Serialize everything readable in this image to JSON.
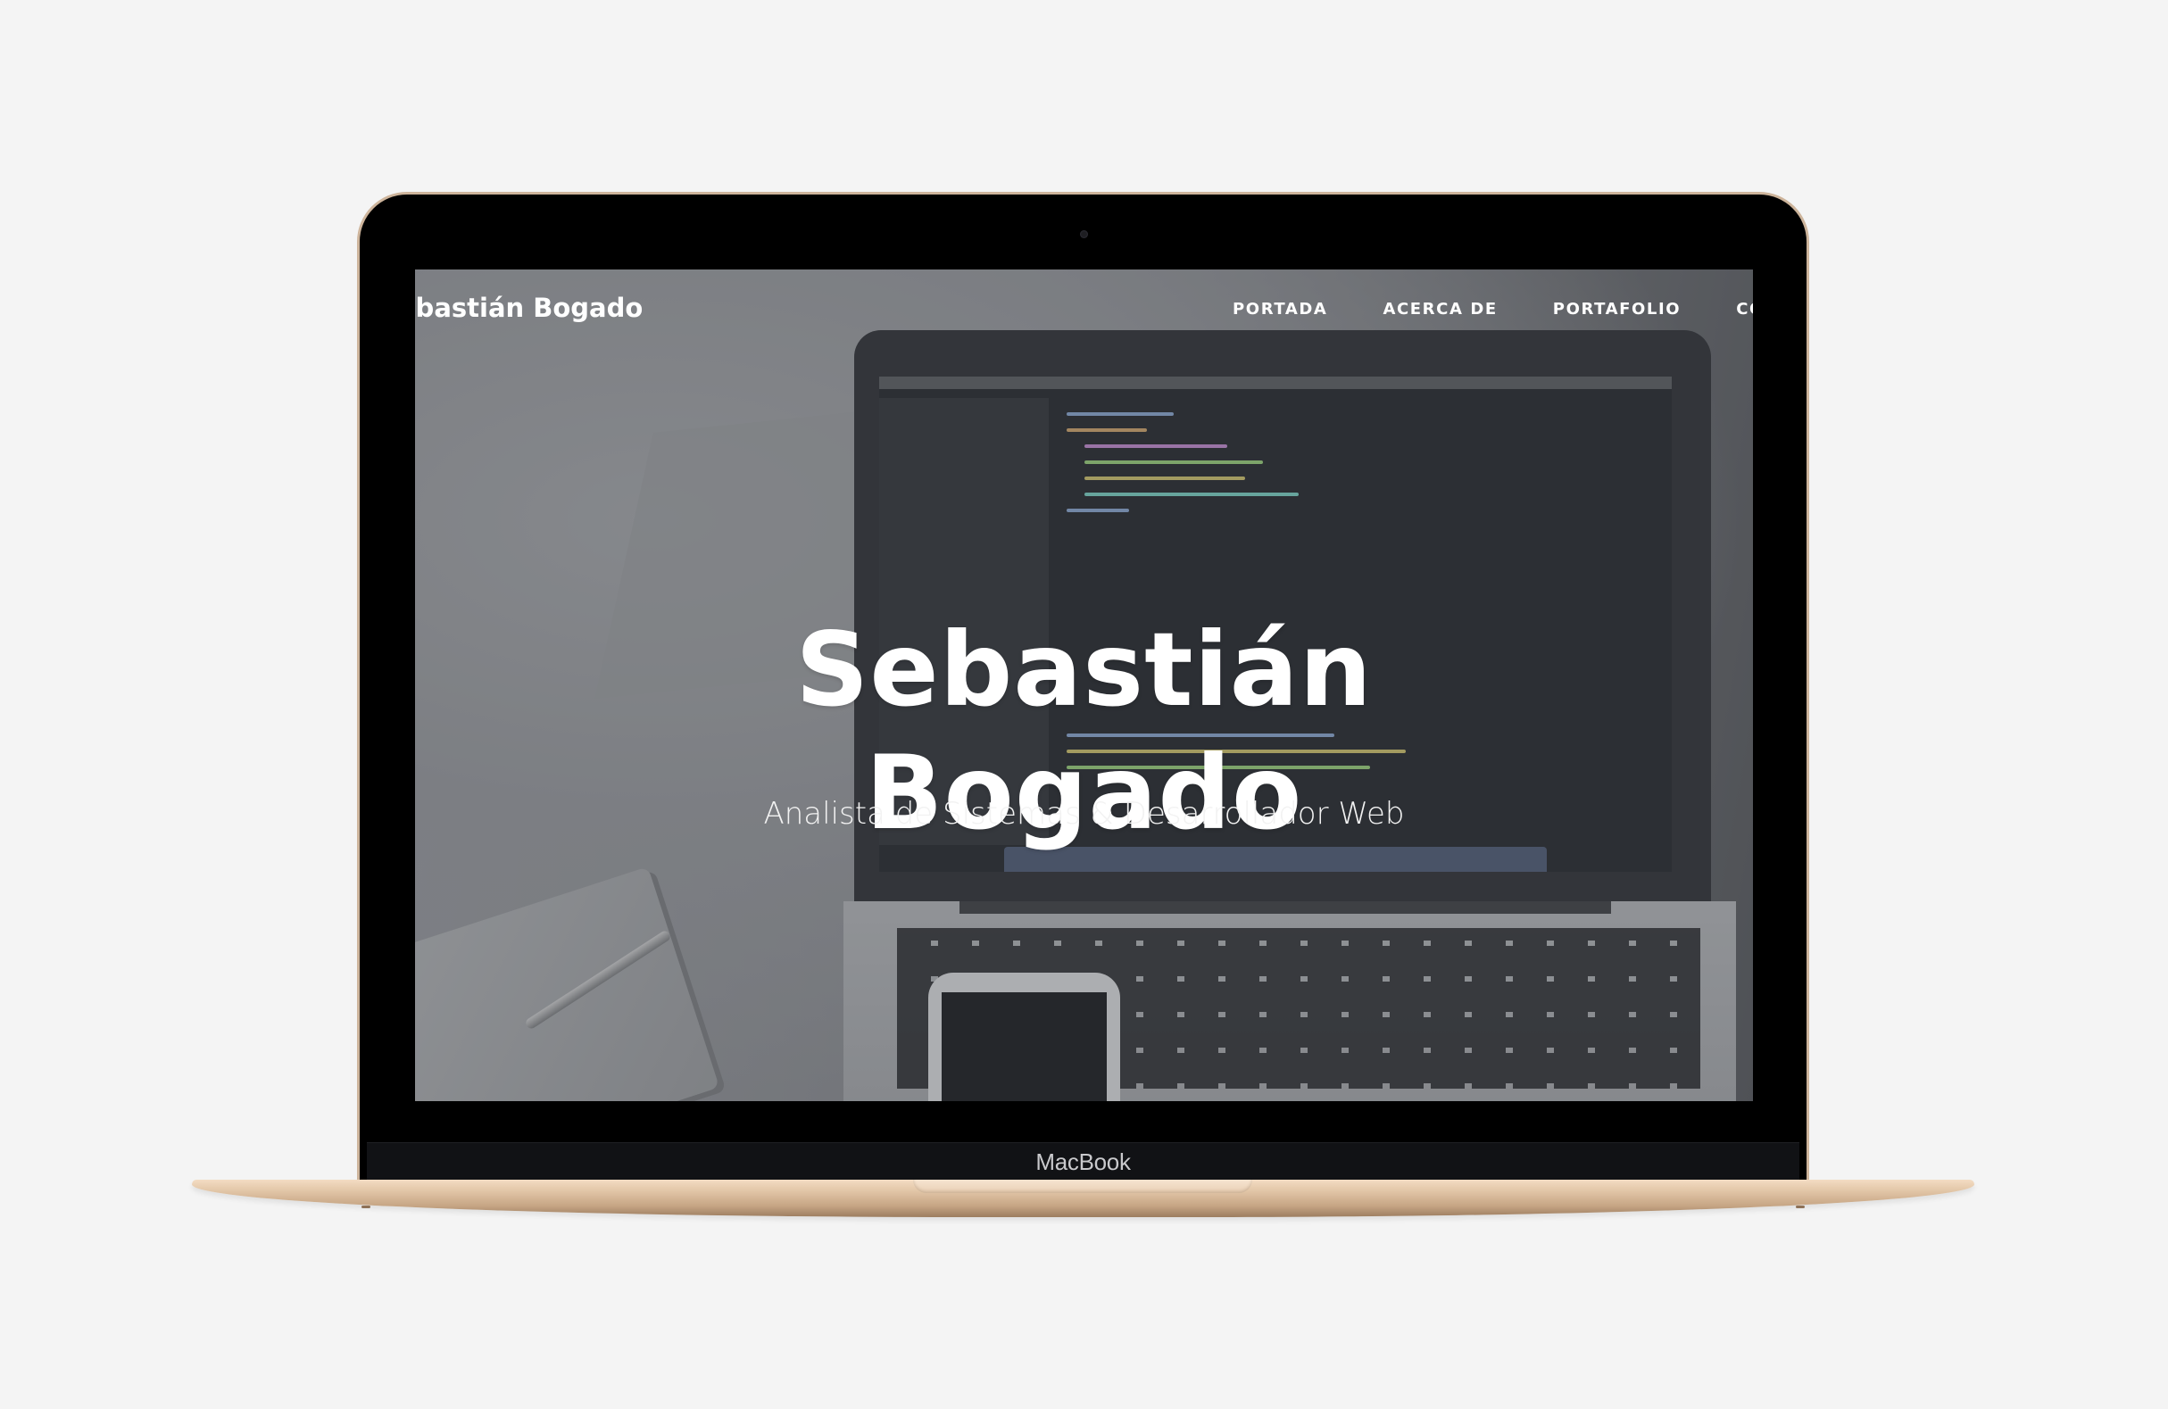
{
  "device": {
    "brand_label": "MacBook"
  },
  "site": {
    "logo_text": "Sebastián Bogado",
    "nav": [
      {
        "label": "PORTADA"
      },
      {
        "label": "ACERCA DE"
      },
      {
        "label": "PORTAFOLIO"
      },
      {
        "label": "CONTACTO"
      }
    ]
  },
  "hero": {
    "title_line1": "Sebastián",
    "title_line2": "Bogado",
    "subtitle": "Analista de Sistemas & Desarrollador Web"
  },
  "colors": {
    "page_background": "#f4f4f4",
    "bezel": "#000000",
    "gold_frame": "#cdb49b",
    "text": "#ffffff"
  }
}
